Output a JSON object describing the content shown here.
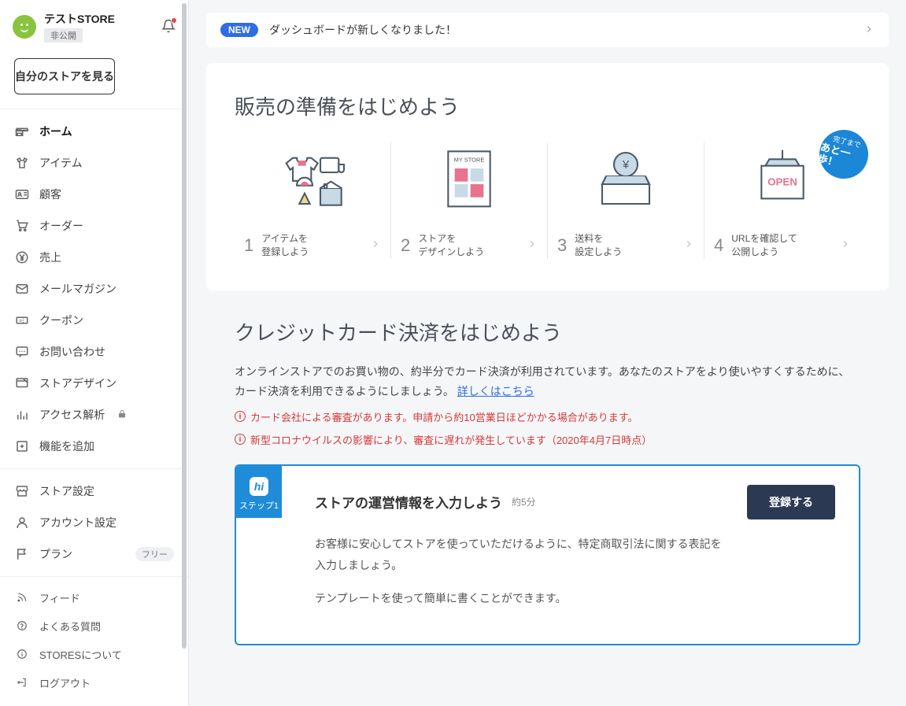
{
  "store": {
    "name": "テストSTORE",
    "status": "非公開"
  },
  "sidebar": {
    "view_store": "自分のストアを見る",
    "nav1": [
      {
        "label": "ホーム",
        "icon": "home"
      },
      {
        "label": "アイテム",
        "icon": "shirt"
      },
      {
        "label": "顧客",
        "icon": "id"
      },
      {
        "label": "オーダー",
        "icon": "cart"
      },
      {
        "label": "売上",
        "icon": "yen"
      },
      {
        "label": "メールマガジン",
        "icon": "mail"
      },
      {
        "label": "クーポン",
        "icon": "coupon"
      },
      {
        "label": "お問い合わせ",
        "icon": "chat"
      },
      {
        "label": "ストアデザイン",
        "icon": "design"
      },
      {
        "label": "アクセス解析",
        "icon": "chart",
        "lock": true
      },
      {
        "label": "機能を追加",
        "icon": "plus"
      }
    ],
    "nav2": [
      {
        "label": "ストア設定",
        "icon": "storefront"
      },
      {
        "label": "アカウント設定",
        "icon": "user"
      },
      {
        "label": "プラン",
        "icon": "flag",
        "badge": "フリー"
      }
    ],
    "nav3": [
      {
        "label": "フィード",
        "icon": "rss"
      },
      {
        "label": "よくある質問",
        "icon": "help"
      },
      {
        "label": "STORESについて",
        "icon": "info"
      },
      {
        "label": "ログアウト",
        "icon": "logout"
      }
    ]
  },
  "banner": {
    "new": "NEW",
    "text": "ダッシュボードが新しくなりました！"
  },
  "prep": {
    "title": "販売の準備をはじめよう",
    "steps": [
      {
        "num": "1",
        "line1": "アイテムを",
        "line2": "登録しよう"
      },
      {
        "num": "2",
        "line1": "ストアを",
        "line2": "デザインしよう"
      },
      {
        "num": "3",
        "line1": "送料を",
        "line2": "設定しよう"
      },
      {
        "num": "4",
        "line1": "URLを確認して",
        "line2": "公開しよう"
      }
    ],
    "badge": {
      "l1": "完了まで",
      "l2": "あと一歩！"
    }
  },
  "cc": {
    "title": "クレジットカード決済をはじめよう",
    "body": "オンラインストアでのお買い物の、約半分でカード決済が利用されています。あなたのストアをより使いやすくするために、カード決済を利用できるようにしましょう。 ",
    "link": "詳しくはこちら",
    "warn1": "カード会社による審査があります。申請から約10営業日ほどかかる場合があります。",
    "warn2": "新型コロナウイルスの影響により、審査に遅れが発生しています（2020年4月7日時点）"
  },
  "card": {
    "step": "ステップ1",
    "title": "ストアの運営情報を入力しよう",
    "time": "約5分",
    "btn": "登録する",
    "p1": "お客様に安心してストアを使っていただけるように、特定商取引法に関する表記を入力しましょう。",
    "p2": "テンプレートを使って簡単に書くことができます。"
  }
}
